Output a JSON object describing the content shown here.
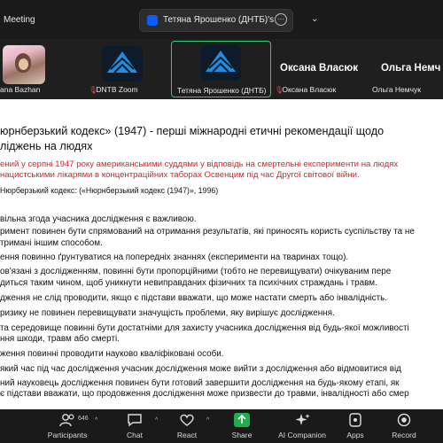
{
  "window": {
    "meeting_label": "Meeting"
  },
  "share_tab": {
    "label": "Тетяна Ярошенко (ДНТБ)'s scree",
    "more": "···",
    "chevron": "⌄"
  },
  "participants": [
    {
      "name": "ana Bazhan",
      "muted": false
    },
    {
      "name": "DNTB Zoom",
      "muted": true
    },
    {
      "name": "Тетяна Ярошенко (ДНТБ)",
      "muted": false
    },
    {
      "name": "Оксана Власюк",
      "display": "Оксана Власюк",
      "muted": true
    },
    {
      "name": "Ольга Немчук",
      "display": "Ольга Немч",
      "muted": false
    }
  ],
  "document": {
    "title": "юрнберзький кодекс» (1947) -  перші  міжнародні етичні рекомендації щодо\nліджень на людях",
    "red_line_1": "ений у серпні 1947 року американськими суддями у відповідь на смертельні експерименти на людях",
    "red_line_2": "нацистськими лікарями в концентраційних таборах Освенцим під час Другої світової війни.",
    "source": "Нюрберзький кодекс: («Нюрнберзький кодекс (1947)», 1996)",
    "items": [
      "вільна згода учасника дослідження є важливою.",
      "римент повинен бути спрямований на отримання результатів, які приносять користь суспільству та не",
      "тримані іншим способом.",
      "ення повинно ґрунтуватися на попередніх знаннях (експерименти на тваринах тощо).",
      "ов'язані з дослідженням, повинні бути пропорційними (тобто не перевищувати) очікуваним пере",
      "диться таким чином, щоб уникнути невиправданих фізичних та психічних страждань і травм.",
      "дження не слід проводити, якщо є підстави вважати, що може настати смерть або інвалідність.",
      "ризику не повинен перевищувати значущість проблеми, яку вирішує дослідження.",
      "та середовище повинні бути достатніми для захисту учасника дослідження від будь-якої можливості",
      "ння шкоди, травм або смерті.",
      "ження повинні проводити науково кваліфіковані особи.",
      "який час під час дослідження учасник дослідження може вийти з дослідження або відмовитися від",
      "ний науковець дослідження повинен бути готовий завершити дослідження на будь-якому етапі, як",
      "є підстави вважати, що продовження дослідження може призвести до травми, інвалідності або смер"
    ]
  },
  "toolbar": {
    "participants_label": "Participants",
    "participants_count": "646",
    "chat_label": "Chat",
    "react_label": "React",
    "share_label": "Share",
    "ai_label": "AI Companion",
    "apps_label": "Apps",
    "record_label": "Record"
  },
  "colors": {
    "accent_red": "#d8232a",
    "share_green": "#1fae4e",
    "active_border": "#2ecc71"
  }
}
